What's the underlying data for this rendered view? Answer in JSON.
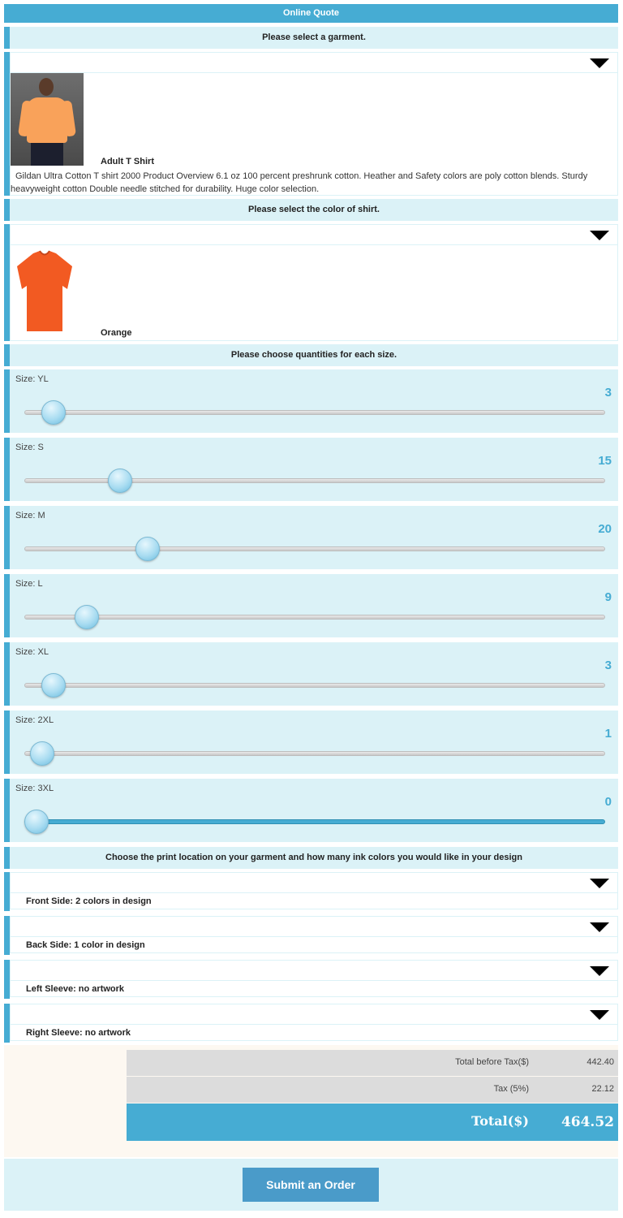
{
  "header": {
    "title": "Online Quote"
  },
  "garment": {
    "heading": "Please select a garment.",
    "name": "Adult T Shirt",
    "description": "Gildan Ultra Cotton T shirt 2000 Product Overview 6.1 oz 100 percent preshrunk cotton. Heather and Safety colors are poly cotton blends. Sturdy heavyweight cotton Double needle stitched for durability. Huge color selection."
  },
  "color": {
    "heading": "Please select the color of shirt.",
    "name": "Orange",
    "swatch": "#f25a22"
  },
  "sizes": {
    "heading": "Please choose quantities for each size.",
    "max": 100,
    "items": [
      {
        "label": "Size: YL",
        "value": 3
      },
      {
        "label": "Size: S",
        "value": 15
      },
      {
        "label": "Size: M",
        "value": 20
      },
      {
        "label": "Size: L",
        "value": 9
      },
      {
        "label": "Size: XL",
        "value": 3
      },
      {
        "label": "Size: 2XL",
        "value": 1
      },
      {
        "label": "Size: 3XL",
        "value": 0
      }
    ]
  },
  "print": {
    "heading": "Choose the print location on your garment and how many ink colors you would like in your design",
    "items": [
      {
        "label": "Front Side: 2 colors in design"
      },
      {
        "label": "Back Side: 1 color in design"
      },
      {
        "label": "Left Sleeve: no artwork"
      },
      {
        "label": "Right Sleeve: no artwork"
      }
    ]
  },
  "totals": {
    "before_tax_label": "Total before Tax($)",
    "before_tax_value": "442.40",
    "tax_label": "Tax (5%)",
    "tax_value": "22.12",
    "total_label": "Total($)",
    "total_value": "464.52"
  },
  "submit": {
    "label": "Submit an Order"
  },
  "colors": {
    "accent": "#46acd3",
    "light": "#dbf2f7"
  }
}
